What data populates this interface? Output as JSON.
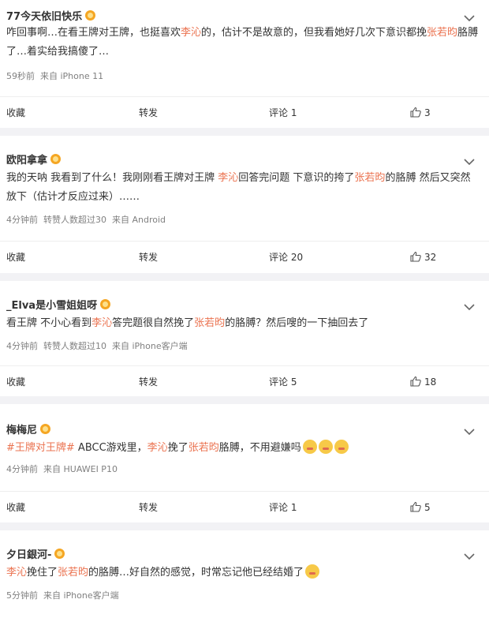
{
  "posts": [
    {
      "user": "77今天依旧快乐",
      "segments": [
        {
          "t": "咋回事啊…在看王牌对王牌，也挺喜欢",
          "c": "n"
        },
        {
          "t": "李沁",
          "c": "h"
        },
        {
          "t": "的，估计不是故意的，但我看她好几次下意识都挽",
          "c": "n"
        },
        {
          "t": "张若昀",
          "c": "h"
        },
        {
          "t": "胳膊了…着实给我搞傻了…",
          "c": "n"
        }
      ],
      "meta": [
        "59秒前",
        "来自 iPhone 11"
      ],
      "collect": "收藏",
      "repost": "转发",
      "comment": "评论 1",
      "likes": "3"
    },
    {
      "user": "欧阳拿拿",
      "segments": [
        {
          "t": "我的天呐 我看到了什么！我刚刚看王牌对王牌 ",
          "c": "n"
        },
        {
          "t": "李沁",
          "c": "h"
        },
        {
          "t": "回答完问题 下意识的挎了",
          "c": "n"
        },
        {
          "t": "张若昀",
          "c": "h"
        },
        {
          "t": "的胳膊 然后又突然放下（估计才反应过来）……",
          "c": "n"
        }
      ],
      "meta": [
        "4分钟前",
        "转赞人数超过30",
        "来自 Android"
      ],
      "collect": "收藏",
      "repost": "转发",
      "comment": "评论 20",
      "likes": "32"
    },
    {
      "user": "_Elva是小雪姐姐呀",
      "segments": [
        {
          "t": "看王牌 不小心看到",
          "c": "n"
        },
        {
          "t": "李沁",
          "c": "h"
        },
        {
          "t": "答完题很自然挽了",
          "c": "n"
        },
        {
          "t": "张若昀",
          "c": "h"
        },
        {
          "t": "的胳膊？然后嗖的一下抽回去了",
          "c": "n"
        }
      ],
      "meta": [
        "4分钟前",
        "转赞人数超过10",
        "来自 iPhone客户端"
      ],
      "collect": "收藏",
      "repost": "转发",
      "comment": "评论 5",
      "likes": "18"
    },
    {
      "user": "梅梅尼",
      "segments": [
        {
          "t": "#王牌对王牌#",
          "c": "h"
        },
        {
          "t": " ABCC游戏里，",
          "c": "n"
        },
        {
          "t": "李沁",
          "c": "h"
        },
        {
          "t": "挽了",
          "c": "n"
        },
        {
          "t": "张若昀",
          "c": "h"
        },
        {
          "t": "胳膊，不用避嫌吗",
          "c": "n"
        }
      ],
      "emoji_count": 3,
      "meta": [
        "4分钟前",
        "来自 HUAWEI P10"
      ],
      "collect": "收藏",
      "repost": "转发",
      "comment": "评论 1",
      "likes": "5"
    },
    {
      "user": "夕日銀河-",
      "segments": [
        {
          "t": "李沁",
          "c": "h"
        },
        {
          "t": "挽住了",
          "c": "n"
        },
        {
          "t": "张若昀",
          "c": "h"
        },
        {
          "t": "的胳膊…好自然的感觉，时常忘记他已经结婚了",
          "c": "n"
        }
      ],
      "emoji_count": 1,
      "meta": [
        "5分钟前",
        "来自 iPhone客户端"
      ]
    }
  ],
  "colors": {
    "highlight": "#eb7350",
    "meta": "#808080",
    "separator": "#f2f2f5"
  },
  "icons": {
    "menu": "chevron-down-icon",
    "like": "thumbs-up-icon",
    "badge": "crown-badge-icon",
    "emoji": "emoji-icon"
  }
}
